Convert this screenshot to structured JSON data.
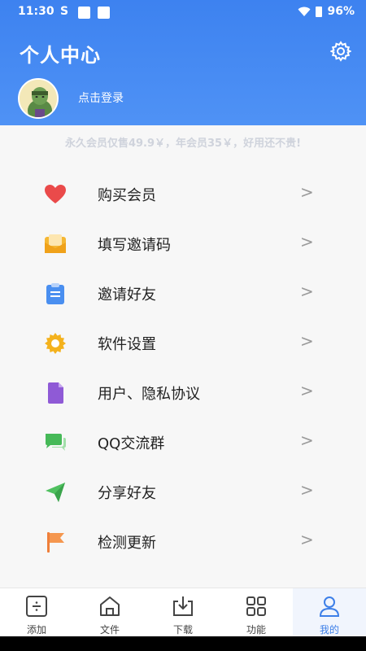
{
  "status_bar": {
    "time": "11:30",
    "s_icon": "S",
    "battery": "96%"
  },
  "header": {
    "title": "个人中心",
    "login_label": "点击登录"
  },
  "promo": "永久会员仅售49.9￥，年会员35￥，好用还不贵!",
  "menu": {
    "items": [
      {
        "label": "购买会员",
        "icon": "heart-icon"
      },
      {
        "label": "填写邀请码",
        "icon": "envelope-icon"
      },
      {
        "label": "邀请好友",
        "icon": "clipboard-icon"
      },
      {
        "label": "软件设置",
        "icon": "gear-icon"
      },
      {
        "label": "用户、隐私协议",
        "icon": "document-icon"
      },
      {
        "label": "QQ交流群",
        "icon": "chat-icon"
      },
      {
        "label": "分享好友",
        "icon": "send-icon"
      },
      {
        "label": "检测更新",
        "icon": "flag-icon"
      }
    ],
    "arrow": ">"
  },
  "tabs": [
    {
      "label": "添加",
      "icon": "add-icon"
    },
    {
      "label": "文件",
      "icon": "home-icon"
    },
    {
      "label": "下载",
      "icon": "download-icon"
    },
    {
      "label": "功能",
      "icon": "grid-icon"
    },
    {
      "label": "我的",
      "icon": "user-icon",
      "active": true
    }
  ],
  "colors": {
    "brand": "#3d82f0",
    "active_tab": "#3d7fe8"
  }
}
